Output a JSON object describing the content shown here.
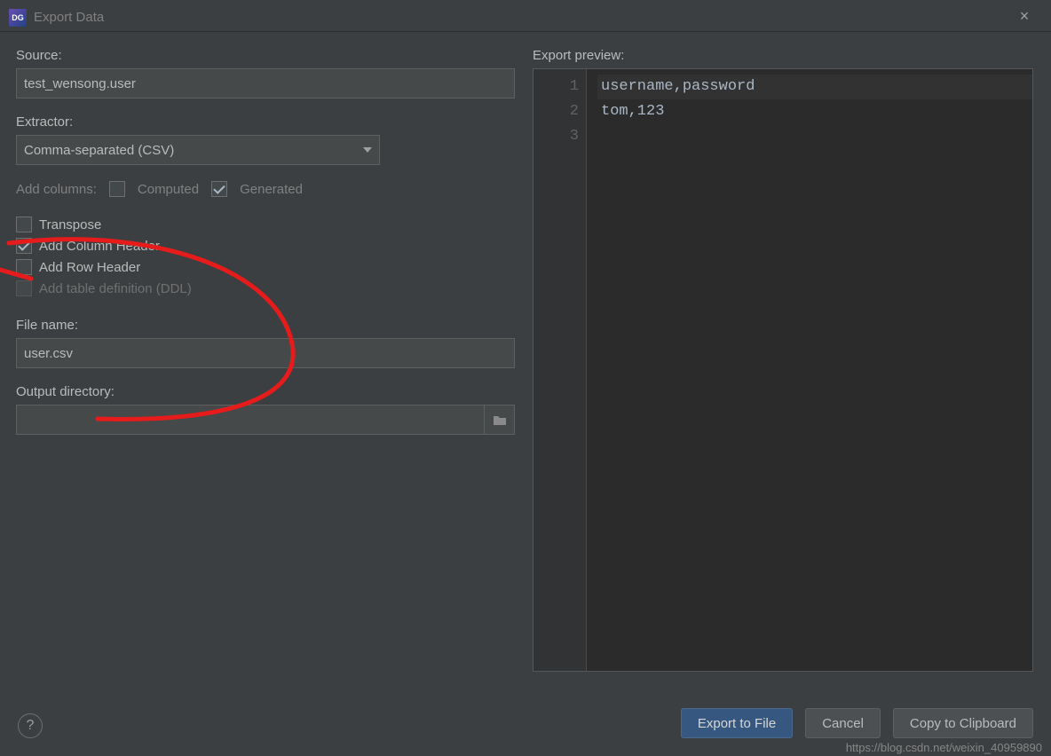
{
  "window": {
    "title": "Export Data",
    "close_icon": "×"
  },
  "form": {
    "source_label": "Source:",
    "source_value": "test_wensong.user",
    "extractor_label": "Extractor:",
    "extractor_value": "Comma-separated (CSV)",
    "add_columns_label": "Add columns:",
    "computed_label": "Computed",
    "computed_checked": false,
    "generated_label": "Generated",
    "generated_checked": true,
    "transpose_label": "Transpose",
    "transpose_checked": false,
    "add_col_header_label": "Add Column Header",
    "add_col_header_checked": true,
    "add_row_header_label": "Add Row Header",
    "add_row_header_checked": false,
    "add_ddl_label": "Add table definition (DDL)",
    "add_ddl_checked": false,
    "filename_label": "File name:",
    "filename_value": "user.csv",
    "output_dir_label": "Output directory:",
    "output_dir_value": ""
  },
  "preview": {
    "label": "Export preview:",
    "lines": [
      "username,password",
      "tom,123",
      ""
    ],
    "line_numbers": [
      "1",
      "2",
      "3"
    ]
  },
  "buttons": {
    "export": "Export to File",
    "cancel": "Cancel",
    "clipboard": "Copy to Clipboard",
    "help": "?"
  },
  "watermark": "https://blog.csdn.net/weixin_40959890"
}
